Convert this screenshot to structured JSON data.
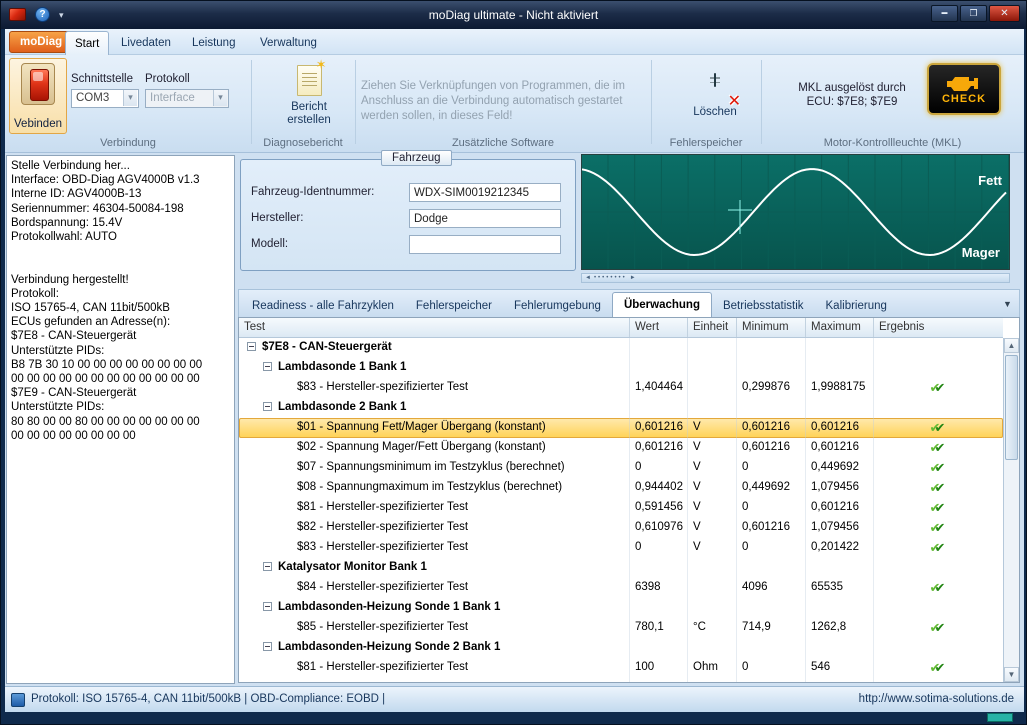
{
  "window": {
    "title": "moDiag ultimate - Nicht aktiviert"
  },
  "ribbon": {
    "app_button": "moDiag",
    "tabs": [
      "Start",
      "Livedaten",
      "Leistung",
      "Verwaltung"
    ],
    "verbindung": {
      "caption": "Verbindung",
      "connect": "Vebinden",
      "if_label": "Schnittstelle",
      "if_value": "COM3",
      "proto_label": "Protokoll",
      "proto_value": "Interface"
    },
    "bericht": {
      "caption": "Diagnosebericht",
      "button": "Bericht erstellen"
    },
    "software": {
      "caption": "Zusätzliche Software",
      "hint": "Ziehen Sie Verknüpfungen von Programmen, die im Anschluss an die Verbindung automatisch gestartet werden sollen, in dieses Feld!"
    },
    "dtc": {
      "caption": "Fehlerspeicher",
      "button": "Löschen"
    },
    "mkl": {
      "caption": "Motor-Kontrollleuchte (MKL)",
      "line1": "MKL ausgelöst durch",
      "line2": "ECU: $7E8; $7E9",
      "check": "CHECK"
    }
  },
  "log_panel": {
    "lines": [
      "Stelle Verbindung her...",
      "Interface: OBD-Diag AGV4000B v1.3",
      "Interne ID: AGV4000B-13",
      "Seriennummer: 46304-50084-198",
      "Bordspannung: 15.4V",
      "Protokollwahl: AUTO",
      "",
      "",
      "Verbindung hergestellt!",
      "Protokoll:",
      "ISO 15765-4, CAN 11bit/500kB",
      "ECUs gefunden an Adresse(n):",
      "$7E8 - CAN-Steuergerät",
      "Unterstützte PIDs:",
      "B8 7B 30 10 00 00 00 00 00 00 00 00",
      "00 00 00 00 00 00 00 00 00 00 00 00",
      "$7E9 - CAN-Steuergerät",
      "Unterstützte PIDs:",
      "80 80 00 00 80 00 00 00 00 00 00 00",
      "00 00 00 00 00 00 00 00"
    ]
  },
  "vehicle": {
    "legend": "Fahrzeug",
    "fields": [
      {
        "label": "Fahrzeug-Identnummer:",
        "value": "WDX-SIM0019212345"
      },
      {
        "label": "Hersteller:",
        "value": "Dodge"
      },
      {
        "label": "Modell:",
        "value": ""
      }
    ]
  },
  "graph": {
    "label_top": "Fett",
    "label_bottom": "Mager"
  },
  "view_tabs": {
    "items": [
      "Readiness - alle Fahrzyklen",
      "Fehlerspeicher",
      "Fehlerumgebung",
      "Überwachung",
      "Betriebsstatistik",
      "Kalibrierung"
    ],
    "active": "Überwachung"
  },
  "table": {
    "columns": [
      "Test",
      "Wert",
      "Einheit",
      "Minimum",
      "Maximum",
      "Ergebnis"
    ],
    "rows": [
      {
        "type": "group",
        "level": 0,
        "label": "$7E8 - CAN-Steuergerät",
        "expander": true
      },
      {
        "type": "group",
        "level": 1,
        "label": "Lambdasonde 1 Bank 1",
        "expander": true
      },
      {
        "type": "test",
        "level": 2,
        "label": "$83 - Hersteller-spezifizierter Test",
        "wert": "1,404464",
        "einheit": "",
        "min": "0,299876",
        "max": "1,9988175",
        "ok": true
      },
      {
        "type": "group",
        "level": 1,
        "label": "Lambdasonde 2 Bank 1",
        "expander": true
      },
      {
        "type": "test",
        "level": 2,
        "label": "$01 - Spannung Fett/Mager Übergang (konstant)",
        "wert": "0,601216",
        "einheit": "V",
        "min": "0,601216",
        "max": "0,601216",
        "ok": true,
        "selected": true
      },
      {
        "type": "test",
        "level": 2,
        "label": "$02 - Spannung Mager/Fett Übergang (konstant)",
        "wert": "0,601216",
        "einheit": "V",
        "min": "0,601216",
        "max": "0,601216",
        "ok": true
      },
      {
        "type": "test",
        "level": 2,
        "label": "$07 - Spannungsminimum im Testzyklus (berechnet)",
        "wert": "0",
        "einheit": "V",
        "min": "0",
        "max": "0,449692",
        "ok": true
      },
      {
        "type": "test",
        "level": 2,
        "label": "$08 - Spannungmaximum im Testzyklus (berechnet)",
        "wert": "0,944402",
        "einheit": "V",
        "min": "0,449692",
        "max": "1,079456",
        "ok": true
      },
      {
        "type": "test",
        "level": 2,
        "label": "$81 - Hersteller-spezifizierter Test",
        "wert": "0,591456",
        "einheit": "V",
        "min": "0",
        "max": "0,601216",
        "ok": true
      },
      {
        "type": "test",
        "level": 2,
        "label": "$82 - Hersteller-spezifizierter Test",
        "wert": "0,610976",
        "einheit": "V",
        "min": "0,601216",
        "max": "1,079456",
        "ok": true
      },
      {
        "type": "test",
        "level": 2,
        "label": "$83 - Hersteller-spezifizierter Test",
        "wert": "0",
        "einheit": "V",
        "min": "0",
        "max": "0,201422",
        "ok": true
      },
      {
        "type": "group",
        "level": 1,
        "label": "Katalysator Monitor Bank 1",
        "expander": true
      },
      {
        "type": "test",
        "level": 2,
        "label": "$84 - Hersteller-spezifizierter Test",
        "wert": "6398",
        "einheit": "",
        "min": "4096",
        "max": "65535",
        "ok": true
      },
      {
        "type": "group",
        "level": 1,
        "label": "Lambdasonden-Heizung Sonde 1 Bank 1",
        "expander": true
      },
      {
        "type": "test",
        "level": 2,
        "label": "$85 - Hersteller-spezifizierter Test",
        "wert": "780,1",
        "einheit": "°C",
        "min": "714,9",
        "max": "1262,8",
        "ok": true
      },
      {
        "type": "group",
        "level": 1,
        "label": "Lambdasonden-Heizung Sonde 2 Bank 1",
        "expander": true
      },
      {
        "type": "test",
        "level": 2,
        "label": "$81 - Hersteller-spezifizierter Test",
        "wert": "100",
        "einheit": "Ohm",
        "min": "0",
        "max": "546",
        "ok": true
      },
      {
        "type": "group",
        "level": 1,
        "label": "",
        "expander": true
      }
    ]
  },
  "statusbar": {
    "left": "Protokoll: ISO 15765-4, CAN 11bit/500kB  |  OBD-Compliance: EOBD |",
    "right": "http://www.sotima-solutions.de"
  }
}
